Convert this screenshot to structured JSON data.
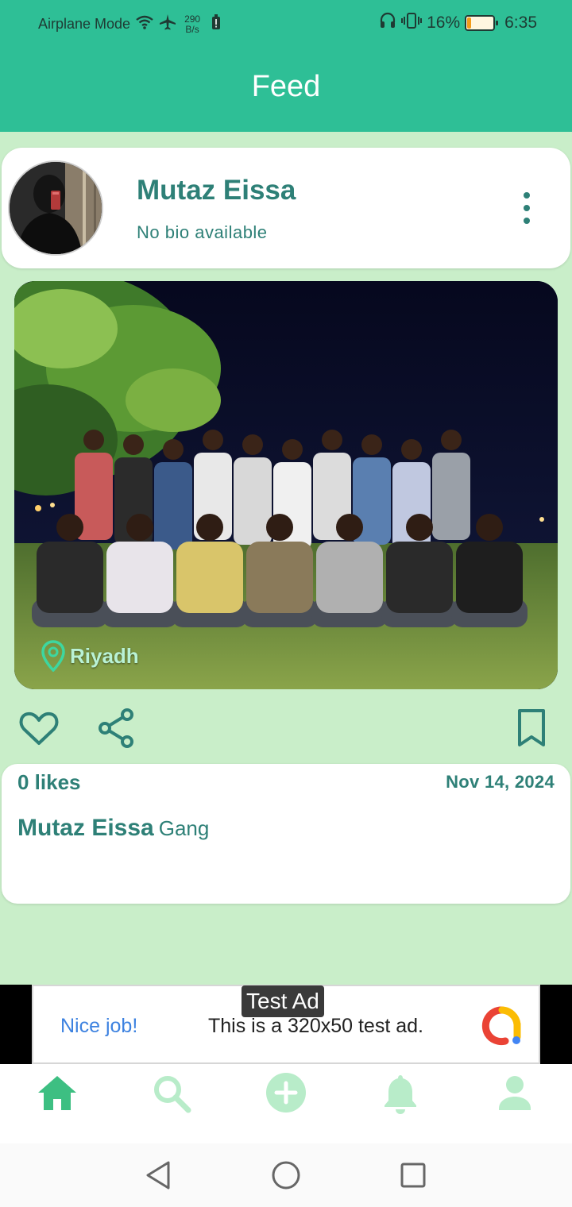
{
  "status_bar": {
    "mode_label": "Airplane Mode",
    "speed_value": "290",
    "speed_unit": "B/s",
    "battery_percent": "16%",
    "battery_level": 0.16,
    "time": "6:35"
  },
  "app_bar": {
    "title": "Feed"
  },
  "post": {
    "author_name": "Mutaz Eissa",
    "author_bio": "No bio available",
    "location": "Riyadh",
    "likes": "0 likes",
    "date": "Nov 14, 2024",
    "caption_author": "Mutaz Eissa",
    "caption_text": "Gang"
  },
  "ad": {
    "badge": "Test Ad",
    "cta": "Nice job!",
    "text": "This is a 320x50 test ad."
  },
  "colors": {
    "app_bar": "#2ebf96",
    "background": "#c9eec9",
    "text_accent": "#2e8077",
    "nav_active": "#3dbf82",
    "nav_inactive": "#b8ecc9"
  },
  "icons": {
    "actions": [
      "heart-icon",
      "share-icon",
      "bookmark-icon"
    ],
    "bottom_nav": [
      "home-icon",
      "search-icon",
      "add-circle-icon",
      "bell-icon",
      "person-icon"
    ],
    "system_nav": [
      "back-triangle-icon",
      "home-circle-icon",
      "recents-square-icon"
    ]
  }
}
